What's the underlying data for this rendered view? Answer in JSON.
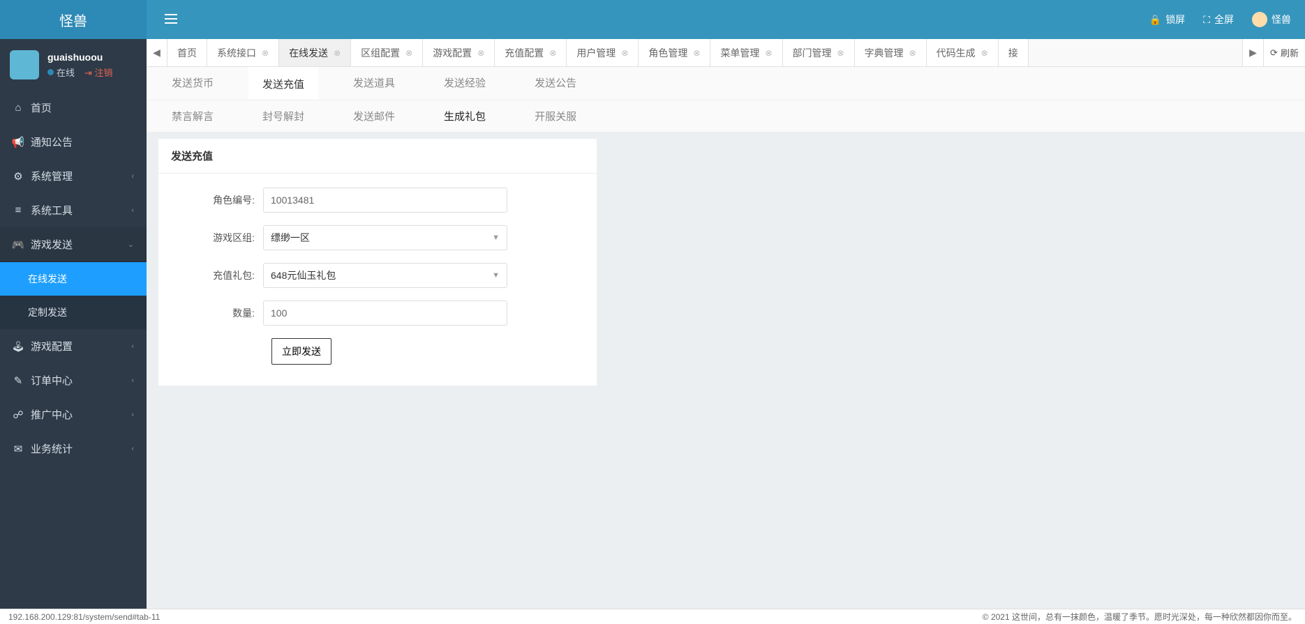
{
  "brand": "怪兽",
  "header": {
    "lock": "锁屏",
    "fullscreen": "全屏",
    "username": "怪兽"
  },
  "user": {
    "name": "guaishuoou",
    "online": "在线",
    "logout": "注销"
  },
  "sidebar": [
    {
      "label": "首页",
      "icon": "⌂"
    },
    {
      "label": "通知公告",
      "icon": "📢"
    },
    {
      "label": "系统管理",
      "icon": "⚙",
      "chev": "‹"
    },
    {
      "label": "系统工具",
      "icon": "≡",
      "chev": "‹"
    },
    {
      "label": "游戏发送",
      "icon": "🎮",
      "chev": "⌄",
      "expanded": true,
      "children": [
        {
          "label": "在线发送",
          "active": true
        },
        {
          "label": "定制发送"
        }
      ]
    },
    {
      "label": "游戏配置",
      "icon": "🕹",
      "chev": "‹"
    },
    {
      "label": "订单中心",
      "icon": "✎",
      "chev": "‹"
    },
    {
      "label": "推广中心",
      "icon": "☍",
      "chev": "‹"
    },
    {
      "label": "业务统计",
      "icon": "✉",
      "chev": "‹"
    }
  ],
  "tabs": {
    "items": [
      {
        "label": "首页",
        "closable": false
      },
      {
        "label": "系统接口",
        "closable": true
      },
      {
        "label": "在线发送",
        "closable": true,
        "active": true
      },
      {
        "label": "区组配置",
        "closable": true
      },
      {
        "label": "游戏配置",
        "closable": true
      },
      {
        "label": "充值配置",
        "closable": true
      },
      {
        "label": "用户管理",
        "closable": true
      },
      {
        "label": "角色管理",
        "closable": true
      },
      {
        "label": "菜单管理",
        "closable": true
      },
      {
        "label": "部门管理",
        "closable": true
      },
      {
        "label": "字典管理",
        "closable": true
      },
      {
        "label": "代码生成",
        "closable": true
      },
      {
        "label": "接",
        "closable": false
      }
    ],
    "refresh": "刷新"
  },
  "sub_tabs_row1": [
    {
      "label": "发送货币"
    },
    {
      "label": "发送充值",
      "active": true
    },
    {
      "label": "发送道具"
    },
    {
      "label": "发送经验"
    },
    {
      "label": "发送公告"
    }
  ],
  "sub_tabs_row2": [
    {
      "label": "禁言解言"
    },
    {
      "label": "封号解封"
    },
    {
      "label": "发送邮件"
    },
    {
      "label": "生成礼包",
      "current": true
    },
    {
      "label": "开服关服"
    }
  ],
  "panel": {
    "title": "发送充值",
    "fields": {
      "role_id_label": "角色编号:",
      "role_id_value": "10013481",
      "zone_label": "游戏区组:",
      "zone_value": "缥缈一区",
      "pack_label": "充值礼包:",
      "pack_value": "648元仙玉礼包",
      "qty_label": "数量:",
      "qty_value": "100",
      "submit": "立即发送"
    }
  },
  "footer": {
    "left": "192.168.200.129:81/system/send#tab-11",
    "right": "© 2021 这世间，总有一抹颜色，温暖了季节。愿时光深处，每一种欣然都因你而至。"
  }
}
